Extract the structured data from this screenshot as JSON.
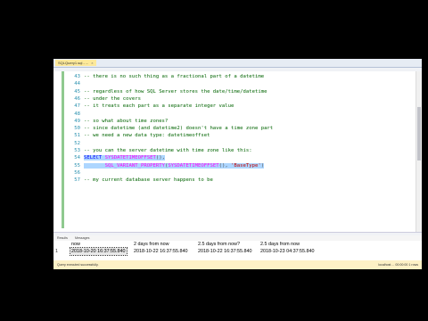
{
  "window": {
    "tab_title": "SQLQuery1.sql - ...",
    "tab_close": "×"
  },
  "editor": {
    "lines": [
      {
        "num": "43",
        "parts": [
          {
            "t": "-- there is no such thing as a fractional part of a datetime",
            "c": "comment"
          }
        ]
      },
      {
        "num": "44",
        "parts": []
      },
      {
        "num": "45",
        "parts": [
          {
            "t": "-- regardless of how SQL Server stores the date/time/datetime",
            "c": "comment"
          }
        ]
      },
      {
        "num": "46",
        "parts": [
          {
            "t": "-- under the covers",
            "c": "comment"
          }
        ]
      },
      {
        "num": "47",
        "parts": [
          {
            "t": "-- it treats each part as a separate integer value",
            "c": "comment"
          }
        ]
      },
      {
        "num": "48",
        "parts": []
      },
      {
        "num": "49",
        "parts": [
          {
            "t": "-- so what about time zones?",
            "c": "comment"
          }
        ]
      },
      {
        "num": "50",
        "parts": [
          {
            "t": "-- since datetime (and datetime2) doesn't have a time zone part",
            "c": "comment"
          }
        ]
      },
      {
        "num": "51",
        "parts": [
          {
            "t": "-- we need a new data type: datetimeoffset",
            "c": "comment"
          }
        ]
      },
      {
        "num": "52",
        "parts": []
      },
      {
        "num": "53",
        "parts": [
          {
            "t": "-- you can the server datetime with time zone like this:",
            "c": "comment"
          }
        ]
      },
      {
        "num": "54",
        "parts": [
          {
            "t": "SELECT",
            "c": "kw"
          },
          {
            "t": " ",
            "c": "plain"
          },
          {
            "t": "SYSDATETIMEOFFSET",
            "c": "fn"
          },
          {
            "t": "(),",
            "c": "punc"
          }
        ],
        "selected": true
      },
      {
        "num": "55",
        "parts": [
          {
            "t": "       ",
            "c": "plain"
          },
          {
            "t": "SQL_VARIANT_PROPERTY",
            "c": "fn"
          },
          {
            "t": "(",
            "c": "punc"
          },
          {
            "t": "SYSDATETIMEOFFSET",
            "c": "fn"
          },
          {
            "t": "(), ",
            "c": "punc"
          },
          {
            "t": "'BaseType'",
            "c": "str"
          },
          {
            "t": ")",
            "c": "punc"
          }
        ],
        "selected": true
      },
      {
        "num": "56",
        "parts": []
      },
      {
        "num": "57",
        "parts": [
          {
            "t": "-- my current database server happens to be",
            "c": "comment"
          }
        ]
      }
    ]
  },
  "results": {
    "tabs": [
      "Results",
      "Messages"
    ],
    "columns": [
      "now",
      "2 days from now",
      "2.5 days from now?",
      "2.5 days from now"
    ],
    "rows": [
      {
        "num": "1",
        "cells": [
          "2018-10-20 16:37:55.840",
          "2018-10-22 16:37:55.840",
          "2018-10-22 16:37:55.840",
          "2018-10-23 04:37:55.840"
        ]
      }
    ]
  },
  "status": {
    "left": "Query executed successfully.",
    "right": "localhost ... 00:00:00  1 rows"
  }
}
